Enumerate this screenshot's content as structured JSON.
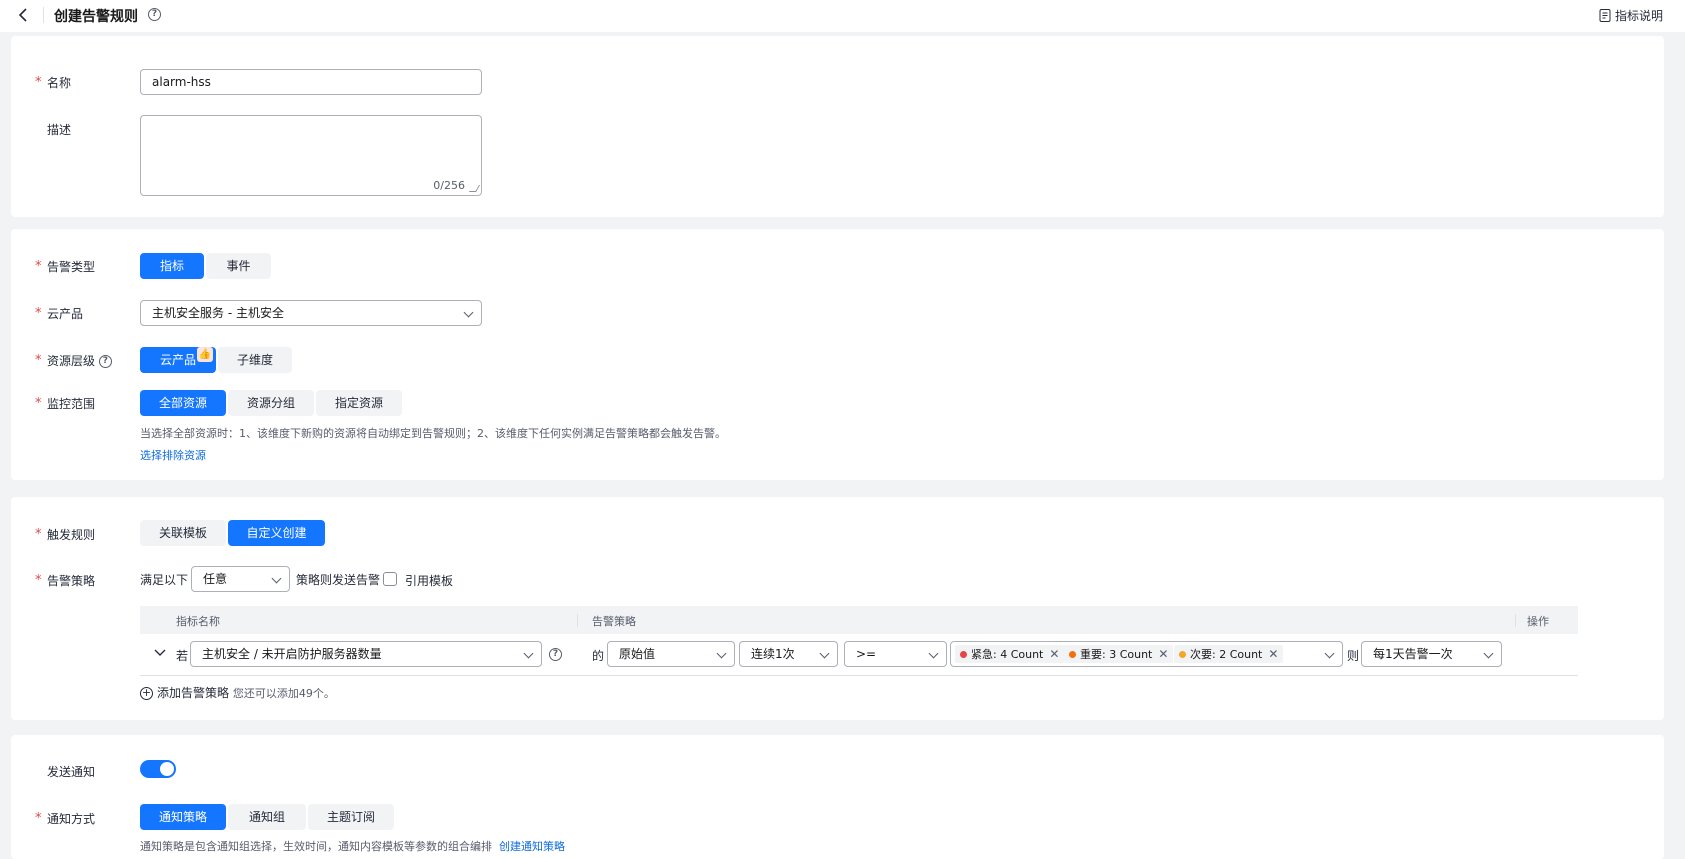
{
  "header": {
    "title": "创建告警规则",
    "help_label": "指标说明"
  },
  "basic": {
    "name_label": "名称",
    "name_value": "alarm-hss",
    "desc_label": "描述",
    "desc_count": "0/256"
  },
  "rule": {
    "type_label": "告警类型",
    "type_options": [
      "指标",
      "事件"
    ],
    "product_label": "云产品",
    "product_value": "主机安全服务 - 主机安全",
    "level_label": "资源层级",
    "level_options": [
      "云产品",
      "子维度"
    ],
    "scope_label": "监控范围",
    "scope_options": [
      "全部资源",
      "资源分组",
      "指定资源"
    ],
    "scope_hint": "当选择全部资源时：1、该维度下新购的资源将自动绑定到告警规则；2、该维度下任何实例满足告警策略都会触发告警。",
    "exclude_link": "选择排除资源"
  },
  "trigger": {
    "label": "触发规则",
    "options": [
      "关联模板",
      "自定义创建"
    ],
    "policy_label": "告警策略",
    "satisfy_prefix": "满足以下",
    "satisfy_value": "任意",
    "satisfy_suffix": "策略则发送告警",
    "template_checkbox": "引用模板",
    "table_headers": {
      "metric": "指标名称",
      "policy": "告警策略",
      "ops": "操作"
    },
    "row": {
      "if_label": "若",
      "metric": "主机安全 / 未开启防护服务器数量",
      "of_label": "的",
      "stat": "原始值",
      "period": "连续1次",
      "op": ">=",
      "tags": [
        {
          "text": "紧急: 4 Count",
          "color": "#e54545"
        },
        {
          "text": "重要: 3 Count",
          "color": "#f66f0f"
        },
        {
          "text": "次要: 2 Count",
          "color": "#f5a623"
        }
      ],
      "then_label": "则",
      "frequency": "每1天告警一次"
    },
    "add_label": "添加告警策略",
    "add_hint": "您还可以添加49个。"
  },
  "notify": {
    "send_label": "发送通知",
    "method_label": "通知方式",
    "method_options": [
      "通知策略",
      "通知组",
      "主题订阅"
    ],
    "hint": "通知策略是包含通知组选择，生效时间，通知内容模板等参数的组合编排",
    "create_link": "创建通知策略"
  },
  "icons": [
    "back-icon",
    "help-circle-icon",
    "doc-icon",
    "chevron-down-icon",
    "thumb-up-icon",
    "add-circle-icon",
    "close-icon"
  ]
}
